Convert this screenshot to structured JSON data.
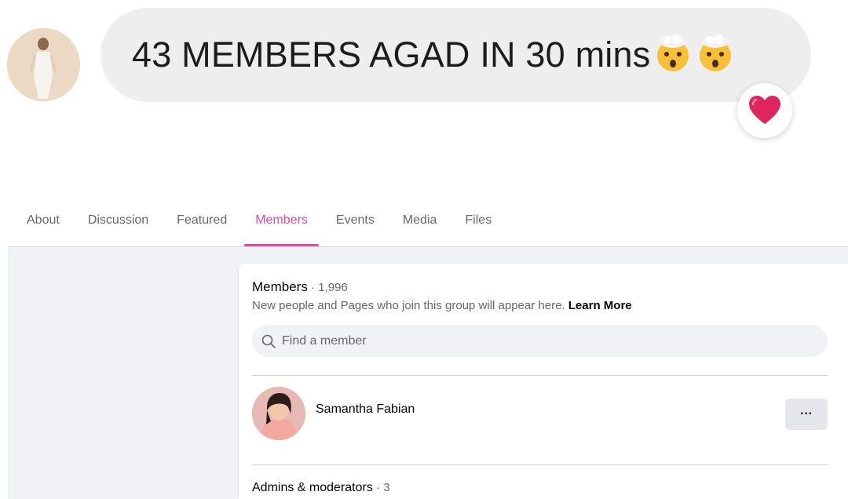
{
  "message": {
    "text": "43 MEMBERS AGAD IN 30 mins",
    "emojis": [
      "exploding-head-emoji",
      "exploding-head-emoji"
    ],
    "reaction": "heart-icon"
  },
  "tabs": [
    {
      "label": "About"
    },
    {
      "label": "Discussion"
    },
    {
      "label": "Featured"
    },
    {
      "label": "Members",
      "active": true
    },
    {
      "label": "Events"
    },
    {
      "label": "Media"
    },
    {
      "label": "Files"
    }
  ],
  "members": {
    "title": "Members",
    "count": "1,996",
    "subtitle": "New people and Pages who join this group will appear here.",
    "learn_more": "Learn More",
    "search_placeholder": "Find a member",
    "list": [
      {
        "name": "Samantha Fabian",
        "more_label": "···"
      }
    ],
    "admins_title": "Admins & moderators",
    "admins_count": "3"
  },
  "colors": {
    "accent": "#e8479c",
    "bubble": "#eeeeef",
    "panel_bg": "#f0f2f5",
    "heart": "#e0245e"
  }
}
